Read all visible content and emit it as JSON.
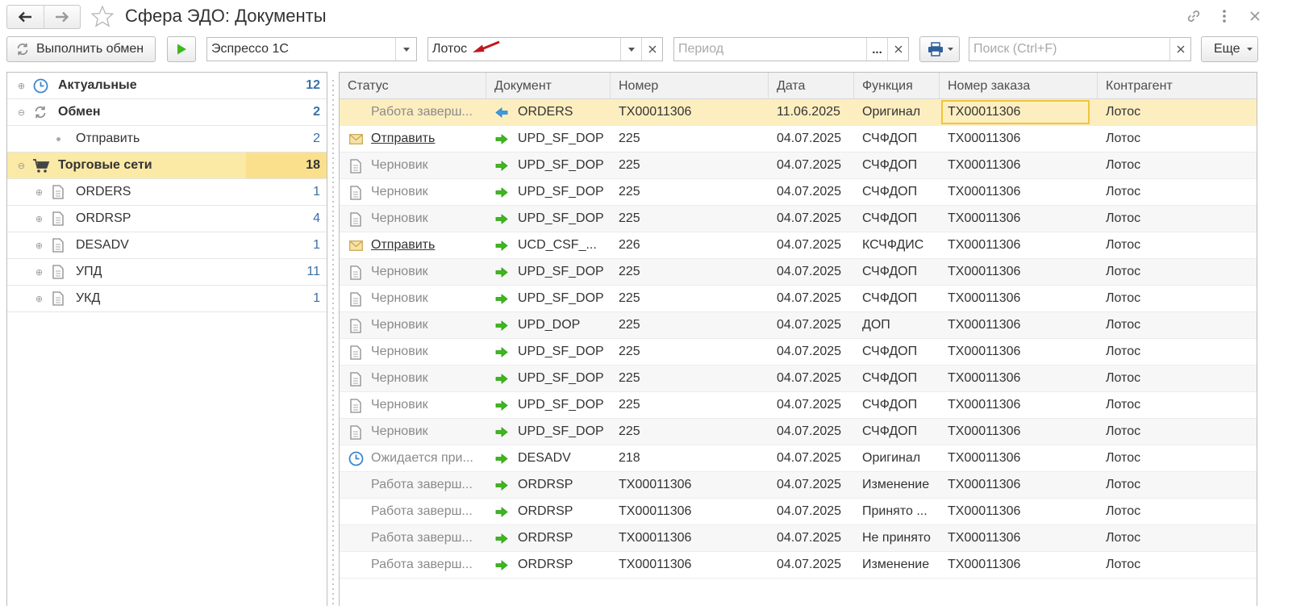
{
  "window": {
    "title": "Сфера ЭДО: Документы"
  },
  "toolbar": {
    "exchange_label": "Выполнить обмен",
    "org_value": "Эспрессо 1С",
    "counterparty_value": "Лотос",
    "period_placeholder": "Период",
    "period_ellipsis": "...",
    "search_placeholder": "Поиск (Ctrl+F)",
    "more_label": "Еще"
  },
  "tree": [
    {
      "label": "Актуальные",
      "count": "12",
      "bold": true
    },
    {
      "label": "Обмен",
      "count": "2",
      "bold": true
    },
    {
      "label": "Отправить",
      "count": "2",
      "bold": false
    },
    {
      "label": "Торговые сети",
      "count": "18",
      "bold": true,
      "selected": true
    },
    {
      "label": "ORDERS",
      "count": "1",
      "bold": false
    },
    {
      "label": "ORDRSP",
      "count": "4",
      "bold": false
    },
    {
      "label": "DESADV",
      "count": "1",
      "bold": false
    },
    {
      "label": "УПД",
      "count": "11",
      "bold": false
    },
    {
      "label": "УКД",
      "count": "1",
      "bold": false
    }
  ],
  "grid": {
    "columns": [
      "Статус",
      "Документ",
      "Номер",
      "Дата",
      "Функция",
      "Номер заказа",
      "Контрагент"
    ],
    "rows": [
      {
        "status": "Работа заверш...",
        "status_icon": "none",
        "dir": "incoming-arrow-icon",
        "doc": "ORDERS",
        "num": "TX00011306",
        "date": "11.06.2025",
        "func": "Оригинал",
        "order": "TX00011306",
        "cp": "Лотос"
      },
      {
        "status": "Отправить",
        "status_icon": "envelope-icon",
        "dir": "outgoing-arrow-icon",
        "doc": "UPD_SF_DOP",
        "num": "225",
        "date": "04.07.2025",
        "func": "СЧФДОП",
        "order": "TX00011306",
        "cp": "Лотос"
      },
      {
        "status": "Черновик",
        "status_icon": "document-icon",
        "dir": "outgoing-arrow-icon",
        "doc": "UPD_SF_DOP",
        "num": "225",
        "date": "04.07.2025",
        "func": "СЧФДОП",
        "order": "TX00011306",
        "cp": "Лотос"
      },
      {
        "status": "Черновик",
        "status_icon": "document-icon",
        "dir": "outgoing-arrow-icon",
        "doc": "UPD_SF_DOP",
        "num": "225",
        "date": "04.07.2025",
        "func": "СЧФДОП",
        "order": "TX00011306",
        "cp": "Лотос"
      },
      {
        "status": "Черновик",
        "status_icon": "document-icon",
        "dir": "outgoing-arrow-icon",
        "doc": "UPD_SF_DOP",
        "num": "225",
        "date": "04.07.2025",
        "func": "СЧФДОП",
        "order": "TX00011306",
        "cp": "Лотос"
      },
      {
        "status": "Отправить",
        "status_icon": "envelope-icon",
        "dir": "outgoing-arrow-icon",
        "doc": "UCD_CSF_...",
        "num": "226",
        "date": "04.07.2025",
        "func": "КСЧФДИС",
        "order": "TX00011306",
        "cp": "Лотос"
      },
      {
        "status": "Черновик",
        "status_icon": "document-icon",
        "dir": "outgoing-arrow-icon",
        "doc": "UPD_SF_DOP",
        "num": "225",
        "date": "04.07.2025",
        "func": "СЧФДОП",
        "order": "TX00011306",
        "cp": "Лотос"
      },
      {
        "status": "Черновик",
        "status_icon": "document-icon",
        "dir": "outgoing-arrow-icon",
        "doc": "UPD_SF_DOP",
        "num": "225",
        "date": "04.07.2025",
        "func": "СЧФДОП",
        "order": "TX00011306",
        "cp": "Лотос"
      },
      {
        "status": "Черновик",
        "status_icon": "document-icon",
        "dir": "outgoing-arrow-icon",
        "doc": "UPD_DOP",
        "num": "225",
        "date": "04.07.2025",
        "func": "ДОП",
        "order": "TX00011306",
        "cp": "Лотос"
      },
      {
        "status": "Черновик",
        "status_icon": "document-icon",
        "dir": "outgoing-arrow-icon",
        "doc": "UPD_SF_DOP",
        "num": "225",
        "date": "04.07.2025",
        "func": "СЧФДОП",
        "order": "TX00011306",
        "cp": "Лотос"
      },
      {
        "status": "Черновик",
        "status_icon": "document-icon",
        "dir": "outgoing-arrow-icon",
        "doc": "UPD_SF_DOP",
        "num": "225",
        "date": "04.07.2025",
        "func": "СЧФДОП",
        "order": "TX00011306",
        "cp": "Лотос"
      },
      {
        "status": "Черновик",
        "status_icon": "document-icon",
        "dir": "outgoing-arrow-icon",
        "doc": "UPD_SF_DOP",
        "num": "225",
        "date": "04.07.2025",
        "func": "СЧФДОП",
        "order": "TX00011306",
        "cp": "Лотос"
      },
      {
        "status": "Черновик",
        "status_icon": "document-icon",
        "dir": "outgoing-arrow-icon",
        "doc": "UPD_SF_DOP",
        "num": "225",
        "date": "04.07.2025",
        "func": "СЧФДОП",
        "order": "TX00011306",
        "cp": "Лотос"
      },
      {
        "status": "Ожидается при...",
        "status_icon": "clock-icon",
        "dir": "outgoing-arrow-icon",
        "doc": "DESADV",
        "num": "218",
        "date": "04.07.2025",
        "func": "Оригинал",
        "order": "TX00011306",
        "cp": "Лотос"
      },
      {
        "status": "Работа заверш...",
        "status_icon": "none",
        "dir": "outgoing-arrow-icon",
        "doc": "ORDRSP",
        "num": "TX00011306",
        "date": "04.07.2025",
        "func": "Изменение",
        "order": "TX00011306",
        "cp": "Лотос"
      },
      {
        "status": "Работа заверш...",
        "status_icon": "none",
        "dir": "outgoing-arrow-icon",
        "doc": "ORDRSP",
        "num": "TX00011306",
        "date": "04.07.2025",
        "func": "Принято ...",
        "order": "TX00011306",
        "cp": "Лотос"
      },
      {
        "status": "Работа заверш...",
        "status_icon": "none",
        "dir": "outgoing-arrow-icon",
        "doc": "ORDRSP",
        "num": "TX00011306",
        "date": "04.07.2025",
        "func": "Не принято",
        "order": "TX00011306",
        "cp": "Лотос"
      },
      {
        "status": "Работа заверш...",
        "status_icon": "none",
        "dir": "outgoing-arrow-icon",
        "doc": "ORDRSP",
        "num": "TX00011306",
        "date": "04.07.2025",
        "func": "Изменение",
        "order": "TX00011306",
        "cp": "Лотос"
      }
    ]
  },
  "colors": {
    "selected_row": "#fdeec0",
    "tree_selected": "#fbe9a6",
    "count_blue": "#3b6fa8",
    "outgoing_arrow": "#3db81e",
    "incoming_arrow": "#3f9ae0",
    "annotation_arrow": "#c0171d"
  }
}
